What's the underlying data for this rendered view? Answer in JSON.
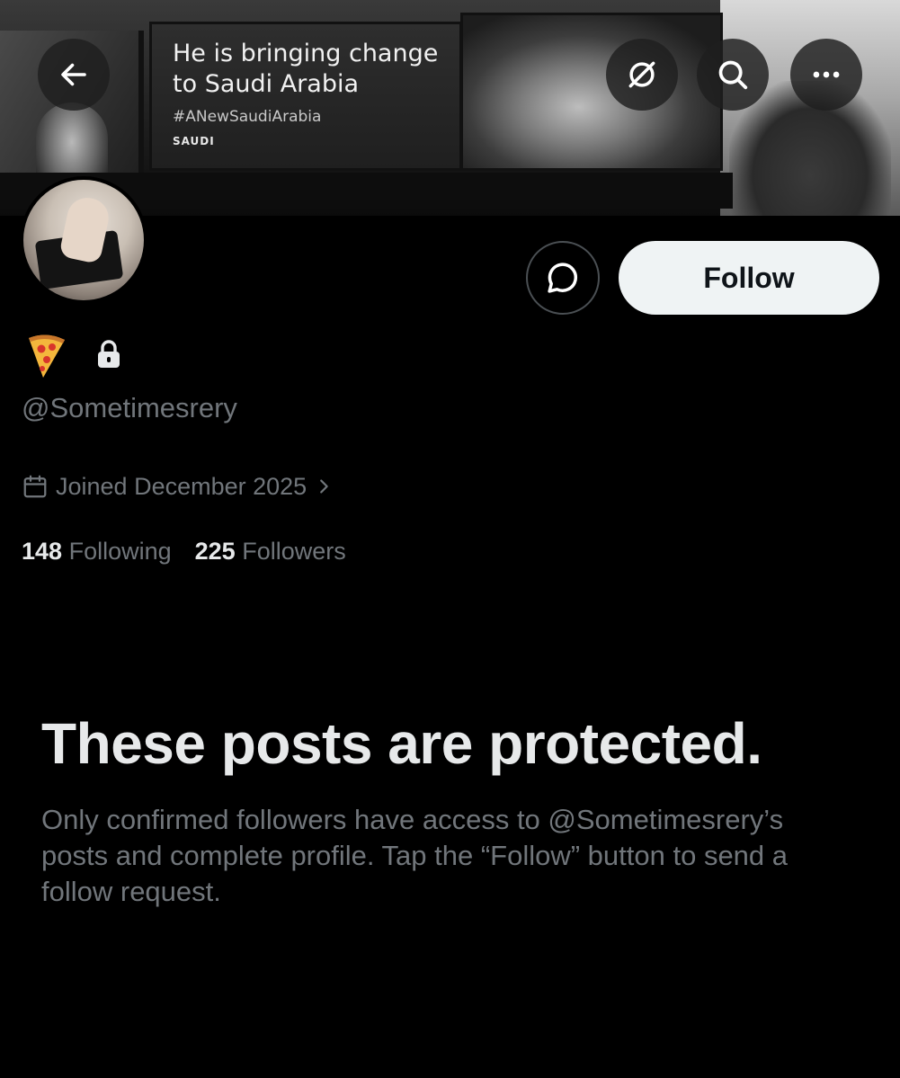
{
  "banner": {
    "billboard_line1": "He is bringing change",
    "billboard_line2": "to Saudi Arabia",
    "billboard_hashtag": "#ANewSaudiArabia",
    "billboard_logo": "SAUDI"
  },
  "header": {
    "back_icon": "back-arrow-icon",
    "grok_icon": "grok-icon",
    "search_icon": "search-icon",
    "more_icon": "more-icon"
  },
  "profile": {
    "name_emoji": "pizza-icon",
    "protected_icon": "lock-icon",
    "handle": "@Sometimesrery",
    "joined": "Joined December 2025",
    "following_count": "148",
    "following_label": "Following",
    "followers_count": "225",
    "followers_label": "Followers"
  },
  "actions": {
    "message_icon": "message-icon",
    "follow_label": "Follow"
  },
  "protected": {
    "title": "These posts are protected.",
    "body": "Only confirmed followers have access to @Sometimesrery’s posts and complete profile. Tap the “Follow” button to send a follow request."
  },
  "colors": {
    "background": "#000000",
    "primary_text": "#e7e9ea",
    "secondary_text": "#71767b",
    "follow_button_bg": "#eff3f4"
  }
}
